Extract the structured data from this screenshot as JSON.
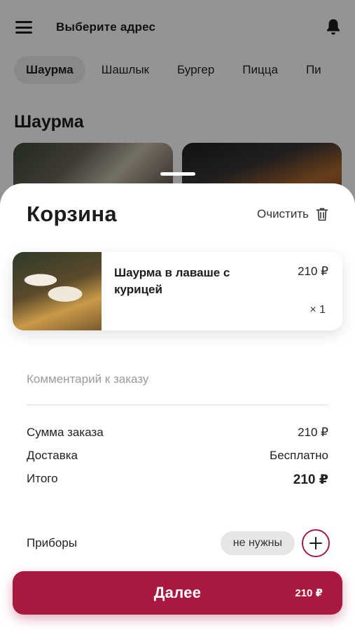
{
  "header": {
    "address_label": "Выберите адрес"
  },
  "categories": [
    {
      "label": "Шаурма",
      "active": true
    },
    {
      "label": "Шашлык",
      "active": false
    },
    {
      "label": "Бургер",
      "active": false
    },
    {
      "label": "Пицца",
      "active": false
    },
    {
      "label": "Пи",
      "active": false
    }
  ],
  "section": {
    "title": "Шаурма"
  },
  "cart": {
    "title": "Корзина",
    "clear_label": "Очистить",
    "item": {
      "name": "Шаурма в лаваше с курицей",
      "price": "210 ₽",
      "qty": "× 1"
    },
    "comment_placeholder": "Комментарий к заказу",
    "summary": {
      "order_sum_label": "Сумма заказа",
      "order_sum_value": "210 ₽",
      "delivery_label": "Доставка",
      "delivery_value": "Бесплатно",
      "total_label": "Итого",
      "total_value": "210 ₽"
    },
    "cutlery": {
      "label": "Приборы",
      "value": "не нужны"
    },
    "next": {
      "label": "Далее",
      "price": "210 ₽"
    }
  },
  "colors": {
    "accent": "#a8183f",
    "pill_bg": "#e6e6e6",
    "text": "#1c1c1c"
  },
  "icons": [
    "menu-icon",
    "bell-icon",
    "trash-icon",
    "plus-icon"
  ]
}
